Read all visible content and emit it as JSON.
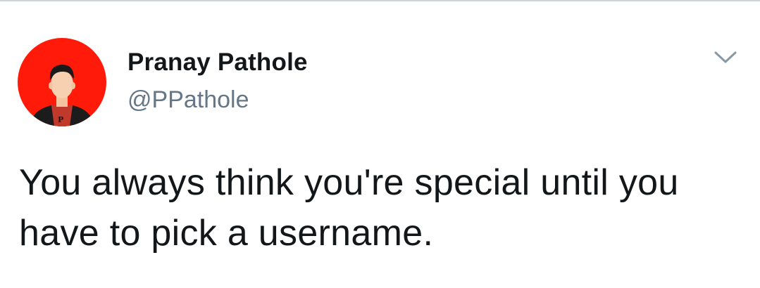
{
  "tweet": {
    "author": {
      "display_name": "Pranay Pathole",
      "handle": "@PPathole",
      "avatar": {
        "icon": "avatar-illustration",
        "background_color": "#ff1a0a",
        "shirt_letter": "P"
      }
    },
    "menu_icon": "chevron-down-icon",
    "text": "You always think you're special until you have to pick a username.",
    "colors": {
      "name": "#14171a",
      "handle": "#657786",
      "text": "#14171a",
      "caret": "#8899a6",
      "divider": "#cfd4d8"
    }
  }
}
